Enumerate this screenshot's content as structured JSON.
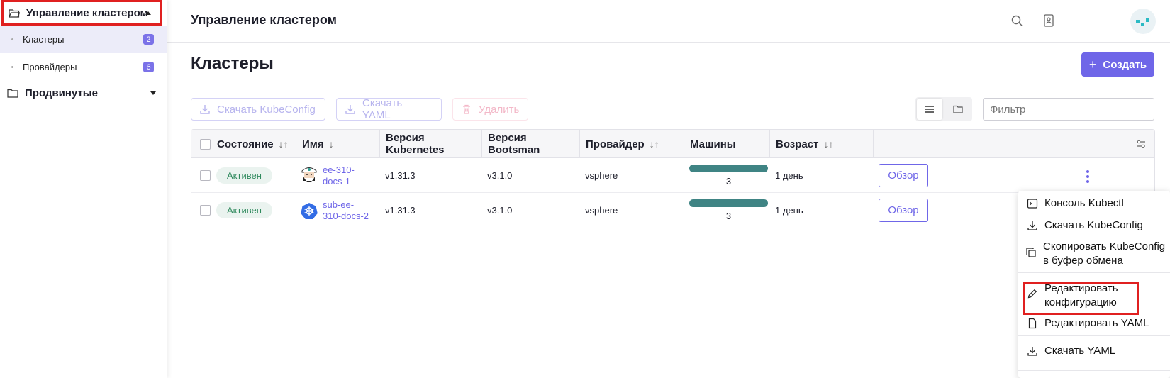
{
  "sidebar": {
    "group_main": "Управление кластером",
    "items": [
      {
        "label": "Кластеры",
        "count": "2"
      },
      {
        "label": "Провайдеры",
        "count": "6"
      }
    ],
    "group_advanced": "Продвинутые"
  },
  "header": {
    "title": "Управление кластером"
  },
  "page": {
    "title": "Кластеры",
    "create_label": "Создать",
    "download_kubeconfig": "Скачать KubeConfig",
    "download_yaml": "Скачать YAML",
    "delete": "Удалить",
    "filter_placeholder": "Фильтр"
  },
  "table": {
    "columns": [
      "Состояние",
      "Имя",
      "Версия Kubernetes",
      "Версия Bootsman",
      "Провайдер",
      "Машины",
      "Возраст"
    ],
    "rows": [
      {
        "status": "Активен",
        "name": "ee-310-docs-1",
        "name_l1": "ee-310-",
        "name_l2": "docs-1",
        "k8s": "v1.31.3",
        "bootsman": "v3.1.0",
        "provider": "vsphere",
        "machines": "3",
        "age": "1 день",
        "action": "Обзор"
      },
      {
        "status": "Активен",
        "name": "sub-ee-310-docs-2",
        "name_l1": "sub-ee-",
        "name_l2": "310-docs-2",
        "k8s": "v1.31.3",
        "bootsman": "v3.1.0",
        "provider": "vsphere",
        "machines": "3",
        "age": "1 день",
        "action": "Обзор"
      }
    ]
  },
  "menu": {
    "kubectl": "Консоль Kubectl",
    "download_kubeconfig": "Скачать KubeConfig",
    "copy_l1": "Скопировать KubeConfig",
    "copy_l2": "в буфер обмена",
    "edit_l1": "Редактировать",
    "edit_l2": "конфигурацию",
    "edit_yaml": "Редактировать YAML",
    "download_yaml": "Скачать YAML"
  },
  "colors": {
    "accent": "#6f66e8",
    "status_green": "#2f8a5d",
    "bar": "#3f8484",
    "highlight": "#e02020"
  }
}
